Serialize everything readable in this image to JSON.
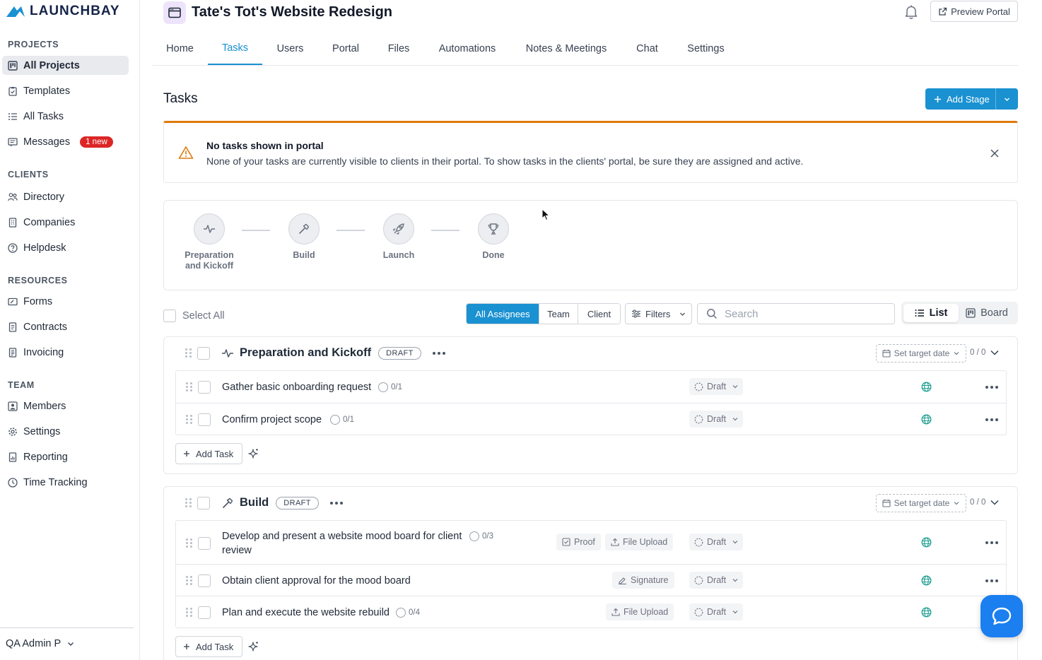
{
  "app": {
    "logo_text": "LAUNCHBAY"
  },
  "sidebar": {
    "sections": [
      {
        "title": "PROJECTS"
      },
      {
        "title": "CLIENTS"
      },
      {
        "title": "RESOURCES"
      },
      {
        "title": "TEAM"
      }
    ],
    "items": [
      {
        "label": "All Projects",
        "icon": "kanban-icon",
        "active": true
      },
      {
        "label": "Templates",
        "icon": "clipboard-check-icon"
      },
      {
        "label": "All Tasks",
        "icon": "list-icon"
      },
      {
        "label": "Messages",
        "icon": "message-icon",
        "badge": "1 new"
      },
      {
        "label": "Directory",
        "icon": "users-icon"
      },
      {
        "label": "Companies",
        "icon": "building-icon"
      },
      {
        "label": "Helpdesk",
        "icon": "help-circle-icon"
      },
      {
        "label": "Forms",
        "icon": "form-icon"
      },
      {
        "label": "Contracts",
        "icon": "document-icon"
      },
      {
        "label": "Invoicing",
        "icon": "invoice-icon"
      },
      {
        "label": "Members",
        "icon": "member-card-icon"
      },
      {
        "label": "Settings",
        "icon": "gear-icon"
      },
      {
        "label": "Reporting",
        "icon": "report-icon"
      },
      {
        "label": "Time Tracking",
        "icon": "clock-icon"
      }
    ],
    "user": {
      "name": "QA Admin P"
    }
  },
  "header": {
    "project_title": "Tate's Tot's Website Redesign",
    "preview_label": "Preview Portal"
  },
  "tabs": [
    {
      "label": "Home"
    },
    {
      "label": "Tasks",
      "active": true
    },
    {
      "label": "Users"
    },
    {
      "label": "Portal"
    },
    {
      "label": "Files"
    },
    {
      "label": "Automations"
    },
    {
      "label": "Notes & Meetings"
    },
    {
      "label": "Chat"
    },
    {
      "label": "Settings"
    }
  ],
  "page": {
    "title": "Tasks",
    "add_stage_label": "Add Stage"
  },
  "alert": {
    "title": "No tasks shown in portal",
    "message": "None of your tasks are currently visible to clients in their portal. To show tasks in the clients' portal, be sure they are assigned and active."
  },
  "stages": [
    {
      "label": "Preparation and Kickoff",
      "icon": "activity-icon"
    },
    {
      "label": "Build",
      "icon": "hammer-icon"
    },
    {
      "label": "Launch",
      "icon": "rocket-icon"
    },
    {
      "label": "Done",
      "icon": "trophy-icon"
    }
  ],
  "toolbar": {
    "select_all": "Select All",
    "assignee_filters": [
      {
        "label": "All Assignees",
        "active": true
      },
      {
        "label": "Team"
      },
      {
        "label": "Client"
      }
    ],
    "filters_label": "Filters",
    "search_placeholder": "Search",
    "views": [
      {
        "label": "List",
        "active": true
      },
      {
        "label": "Board"
      }
    ]
  },
  "groups": [
    {
      "name": "Preparation and Kickoff",
      "status": "DRAFT",
      "target_date_label": "Set target date",
      "count": "0 / 0",
      "add_task_label": "Add Task",
      "tasks": [
        {
          "name": "Gather basic onboarding request",
          "progress": "0/1",
          "status": "Draft"
        },
        {
          "name": "Confirm project scope",
          "progress": "0/1",
          "status": "Draft"
        }
      ]
    },
    {
      "name": "Build",
      "status": "DRAFT",
      "target_date_label": "Set target date",
      "count": "0 / 0",
      "add_task_label": "Add Task",
      "tasks": [
        {
          "name_line1": "Develop and present a website mood board for client",
          "name_line2": "review",
          "progress": "0/3",
          "chips": [
            "Proof",
            "File Upload"
          ],
          "status": "Draft"
        },
        {
          "name": "Obtain client approval for the mood board",
          "chips": [
            "Signature"
          ],
          "status": "Draft"
        },
        {
          "name": "Plan and execute the website rebuild",
          "progress": "0/4",
          "chips": [
            "File Upload"
          ],
          "status": "Draft"
        }
      ]
    }
  ],
  "colors": {
    "accent": "#1a91d1",
    "alert_border": "#e0790a",
    "badge": "#dc2626",
    "globe": "#1a9e8f",
    "help_fab": "#1b7ff0"
  }
}
